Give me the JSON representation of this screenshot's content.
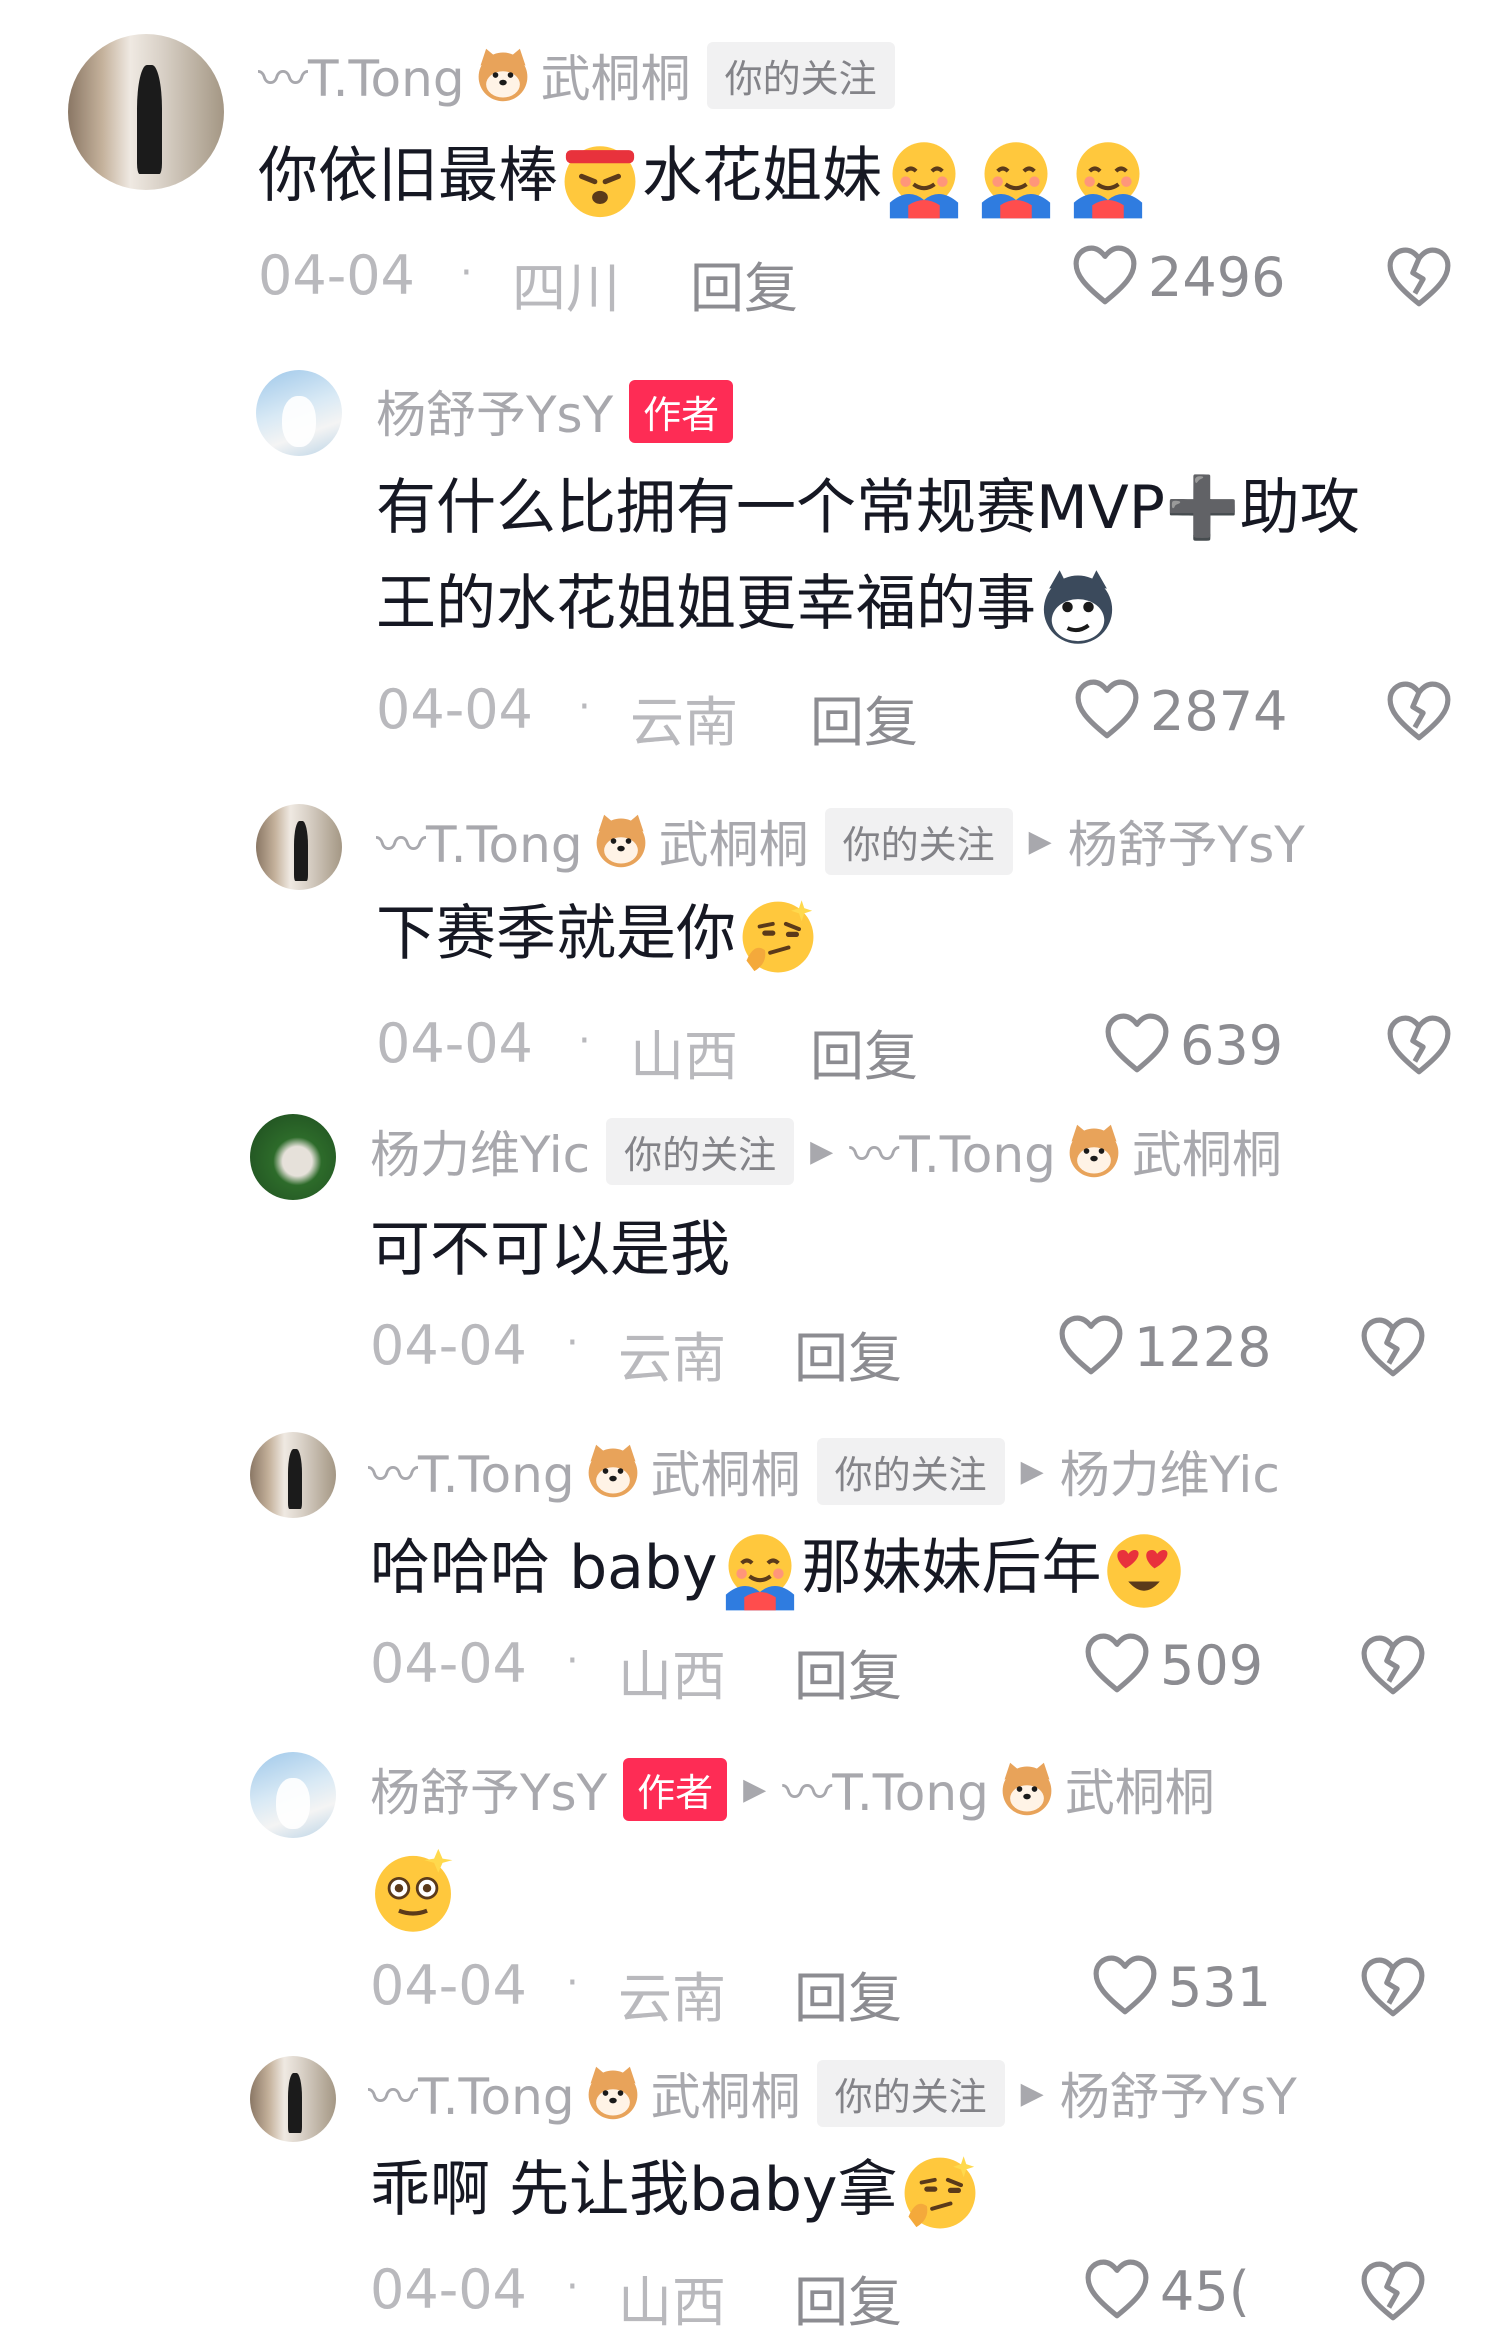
{
  "comments": [
    {
      "user": "〰T.Tong",
      "user_suffix": "武桐桐",
      "follow_tag": "你的关注",
      "text_a": "你依旧最棒",
      "text_b": "水花姐妹",
      "date": "04-04",
      "location": "四川",
      "reply": "回复",
      "likes": "2496"
    },
    {
      "user": "杨舒予YsY",
      "author_tag": "作者",
      "text_line1": "有什么比拥有一个常规赛MVP➕助攻",
      "text_line2": "王的水花姐姐更幸福的事",
      "date": "04-04",
      "location": "云南",
      "reply": "回复",
      "likes": "2874"
    },
    {
      "user": "〰T.Tong",
      "user_suffix": "武桐桐",
      "follow_tag": "你的关注",
      "reply_to": "杨舒予YsY",
      "text": "下赛季就是你",
      "date": "04-04",
      "location": "山西",
      "reply": "回复",
      "likes": "639"
    },
    {
      "user": "杨力维Yic",
      "follow_tag": "你的关注",
      "reply_to": "〰T.Tong",
      "reply_to_suffix": "武桐桐",
      "text": "可不可以是我",
      "date": "04-04",
      "location": "云南",
      "reply": "回复",
      "likes": "1228"
    },
    {
      "user": "〰T.Tong",
      "user_suffix": "武桐桐",
      "follow_tag": "你的关注",
      "reply_to": "杨力维Yic",
      "text_a": "哈哈哈 baby",
      "text_b": "那妹妹后年",
      "date": "04-04",
      "location": "山西",
      "reply": "回复",
      "likes": "509"
    },
    {
      "user": "杨舒予YsY",
      "author_tag": "作者",
      "reply_to": "〰T.Tong",
      "reply_to_suffix": "武桐桐",
      "date": "04-04",
      "location": "云南",
      "reply": "回复",
      "likes": "531"
    },
    {
      "user": "〰T.Tong",
      "user_suffix": "武桐桐",
      "follow_tag": "你的关注",
      "reply_to": "杨舒予YsY",
      "text": "乖啊 先让我baby拿",
      "date": "04-04",
      "location": "山西",
      "reply": "回复",
      "likes": "45("
    }
  ],
  "colors": {
    "author_tag": "#fe2c55",
    "text": "#161823",
    "muted": "#a8a8ad"
  }
}
